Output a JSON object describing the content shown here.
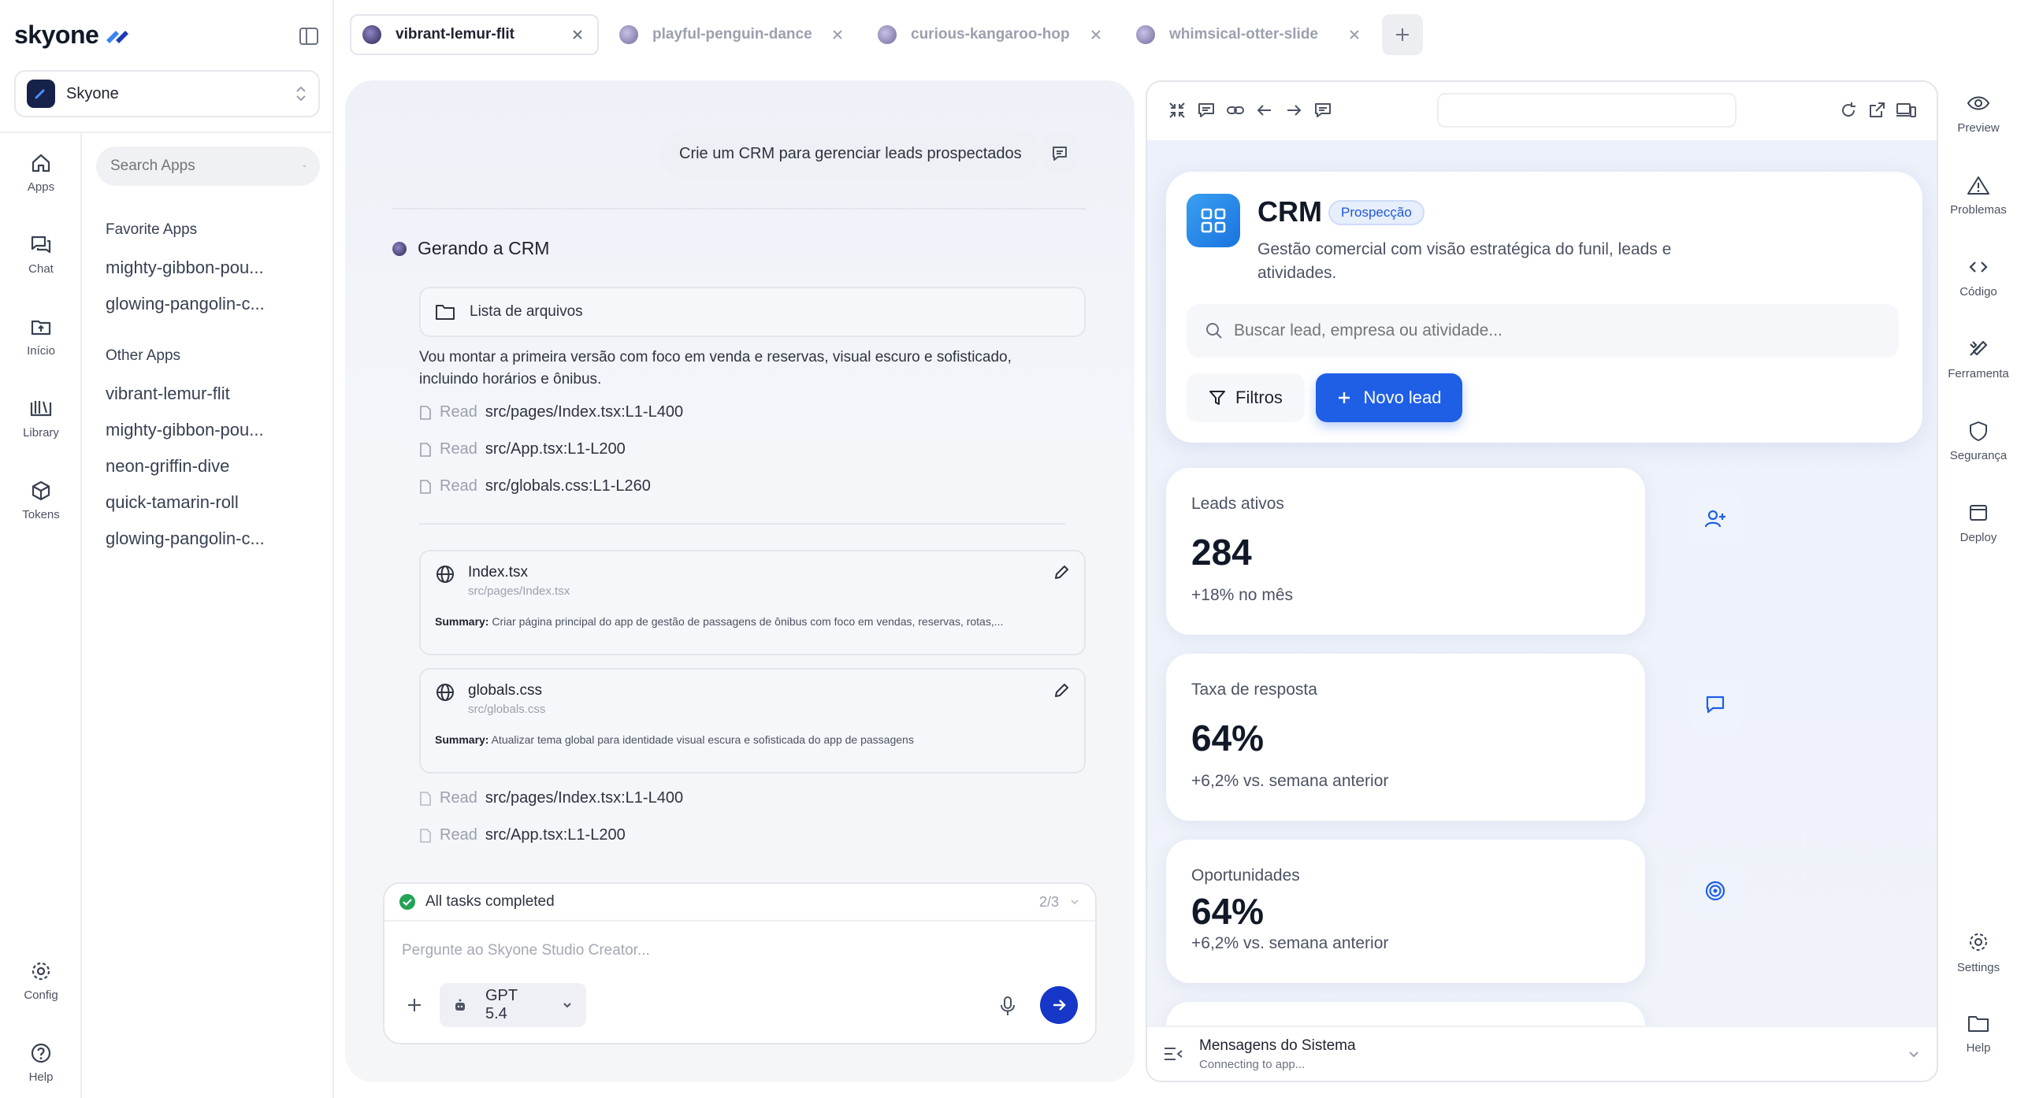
{
  "brand": {
    "name": "skyone"
  },
  "workspace": {
    "name": "Skyone"
  },
  "rail": [
    {
      "label": "Apps",
      "icon": "home-icon"
    },
    {
      "label": "Chat",
      "icon": "chat-icon"
    },
    {
      "label": "Início",
      "icon": "upload-folder-icon"
    },
    {
      "label": "Library",
      "icon": "library-icon"
    },
    {
      "label": "Tokens",
      "icon": "cube-icon"
    },
    {
      "label": "Config",
      "icon": "gear-icon"
    },
    {
      "label": "Help",
      "icon": "help-icon"
    }
  ],
  "search": {
    "placeholder": "Search Apps"
  },
  "favorite_title": "Favorite Apps",
  "favorite_apps": [
    "mighty-gibbon-pou...",
    "glowing-pangolin-c..."
  ],
  "other_title": "Other Apps",
  "other_apps": [
    "vibrant-lemur-flit",
    "mighty-gibbon-pou...",
    "neon-griffin-dive",
    "quick-tamarin-roll",
    "glowing-pangolin-c..."
  ],
  "tabs": [
    {
      "label": "vibrant-lemur-flit",
      "active": true
    },
    {
      "label": "playful-penguin-dance",
      "active": false
    },
    {
      "label": "curious-kangaroo-hop",
      "active": false
    },
    {
      "label": "whimsical-otter-slide",
      "active": false
    }
  ],
  "chat": {
    "prompt": "Crie um CRM para gerenciar leads prospectados",
    "generating": "Gerando a CRM",
    "file_list": "Lista de arquivos",
    "paragraph": "Vou montar a primeira versão com foco em venda e reservas, visual escuro e sofisticado, incluindo horários e ônibus.",
    "read_label": "Read",
    "reads": [
      {
        "pre": "src/pages/",
        "file": "Index.tsx",
        "range": ":L1-L400"
      },
      {
        "pre": "src/",
        "file": "App.tsx",
        "range": ":L1-L200"
      },
      {
        "pre": "src/",
        "file": "globals.css",
        "range": ":L1-L260"
      }
    ],
    "files": [
      {
        "name": "Index.tsx",
        "path": "src/pages/Index.tsx",
        "summary_label": "Summary:",
        "summary": "Criar página principal do app de gestão de passagens de ônibus com foco em vendas, reservas, rotas,..."
      },
      {
        "name": "globals.css",
        "path": "src/globals.css",
        "summary_label": "Summary:",
        "summary": "Atualizar tema global para identidade visual escura e sofisticada do app de passagens"
      }
    ],
    "reads2": [
      {
        "pre": "src/pages/",
        "file": "Index.tsx",
        "range": ":L1-L400"
      },
      {
        "pre": "src/",
        "file": "App.tsx",
        "range": ":L1-L200"
      }
    ],
    "tasks": "All tasks completed",
    "tasks_count": "2/3",
    "input_placeholder": "Pergunte ao Skyone Studio Creator...",
    "model": "GPT 5.4"
  },
  "crm": {
    "title": "CRM",
    "badge": "Prospecção",
    "subtitle": "Gestão comercial com visão estratégica do funil, leads e atividades.",
    "search_placeholder": "Buscar lead, empresa ou atividade...",
    "filters": "Filtros",
    "new_lead": "Novo lead",
    "stats": [
      {
        "label": "Leads ativos",
        "value": "284",
        "delta": "+18% no mês",
        "icon": "user-plus-icon"
      },
      {
        "label": "Taxa de resposta",
        "value": "64%",
        "delta": "+6,2% vs. semana anterior",
        "icon": "message-square-icon"
      },
      {
        "label": "Oportunidades",
        "value": "64%",
        "delta": "+6,2% vs. semana anterior",
        "icon": "target-icon"
      }
    ]
  },
  "system": {
    "title": "Mensagens do Sistema",
    "status": "Connecting to app..."
  },
  "right_rail": [
    {
      "label": "Preview",
      "icon": "eye-icon"
    },
    {
      "label": "Problemas",
      "icon": "warning-icon"
    },
    {
      "label": "Código",
      "icon": "code-icon"
    },
    {
      "label": "Ferramenta",
      "icon": "tools-icon"
    },
    {
      "label": "Segurança",
      "icon": "shield-icon"
    },
    {
      "label": "Deploy",
      "icon": "deploy-window-icon"
    },
    {
      "label": "Settings",
      "icon": "gear-icon"
    },
    {
      "label": "Help",
      "icon": "folder-help-icon"
    }
  ],
  "colors": {
    "accent": "#1f5fe6",
    "send": "#1637c8",
    "success": "#22a356"
  }
}
